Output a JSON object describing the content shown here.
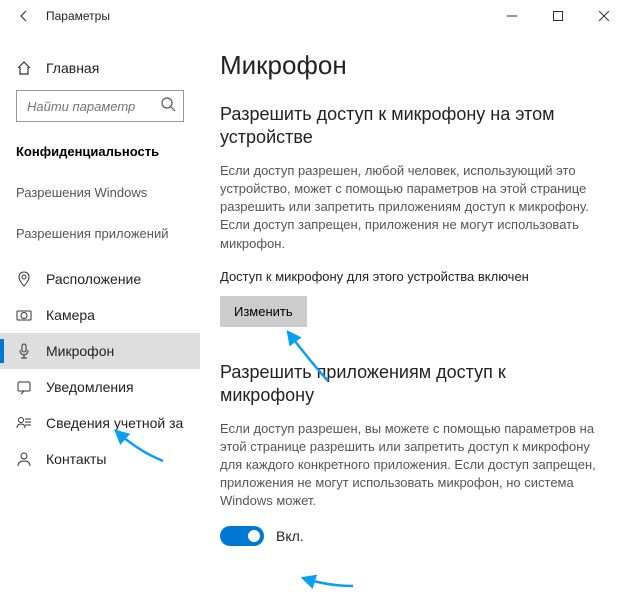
{
  "window": {
    "title": "Параметры"
  },
  "sidebar": {
    "home": "Главная",
    "search_placeholder": "Найти параметр",
    "section": "Конфиденциальность",
    "cat_windows": "Разрешения Windows",
    "cat_apps": "Разрешения приложений",
    "items": {
      "location": "Расположение",
      "camera": "Камера",
      "microphone": "Микрофон",
      "notifications": "Уведомления",
      "account": "Сведения учетной записи",
      "contacts": "Контакты"
    }
  },
  "content": {
    "title": "Микрофон",
    "section1_heading": "Разрешить доступ к микрофону на этом устройстве",
    "section1_body": "Если доступ разрешен, любой человек, использующий это устройство, может с помощью параметров на этой странице разрешить или запретить приложениям доступ к микрофону. Если доступ запрещен, приложения не могут использовать микрофон.",
    "status_text": "Доступ к микрофону для этого устройства включен",
    "change_btn": "Изменить",
    "section2_heading": "Разрешить приложениям доступ к микрофону",
    "section2_body": "Если доступ разрешен, вы можете с помощью параметров на этой странице разрешить или запретить доступ к микрофону для каждого конкретного приложения. Если доступ запрещен, приложения не могут использовать микрофон, но система Windows может.",
    "toggle_label": "Вкл."
  }
}
